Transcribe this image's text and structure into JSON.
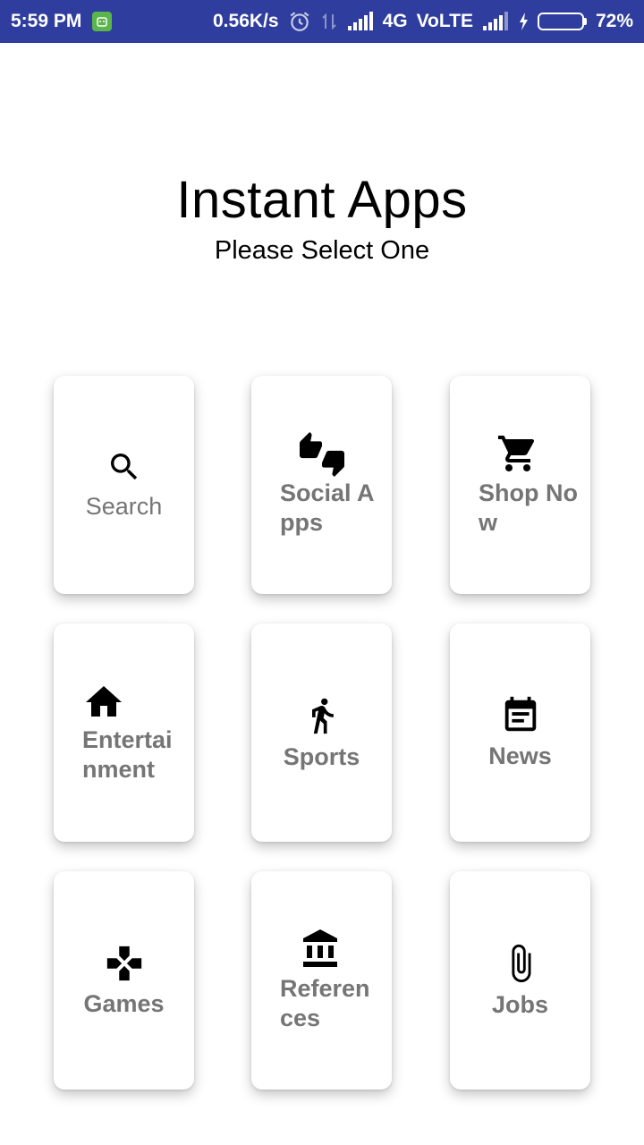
{
  "status_bar": {
    "time": "5:59 PM",
    "network_speed": "0.56K/s",
    "network_type": "4G",
    "volte": "VoLTE",
    "battery_percent": "72%",
    "battery_level": 0.72,
    "background_color": "#2f3e9e",
    "icons": [
      "notification-app-icon",
      "alarm-icon",
      "data-transfer-icon",
      "signal-icon",
      "signal-2-icon",
      "charging-icon",
      "battery-icon"
    ]
  },
  "header": {
    "title": "Instant Apps",
    "subtitle": "Please Select One"
  },
  "categories": [
    {
      "label": "Search",
      "icon": "search-icon"
    },
    {
      "label": "Social Apps",
      "icon": "thumbs-up-down-icon"
    },
    {
      "label": "Shop Now",
      "icon": "shopping-cart-icon"
    },
    {
      "label": "Entertainment",
      "icon": "home-icon"
    },
    {
      "label": "Sports",
      "icon": "walking-person-icon"
    },
    {
      "label": "News",
      "icon": "calendar-note-icon"
    },
    {
      "label": "Games",
      "icon": "gamepad-icon"
    },
    {
      "label": "References",
      "icon": "bank-icon"
    },
    {
      "label": "Jobs",
      "icon": "paperclip-icon"
    }
  ],
  "colors": {
    "label": "#757575",
    "icon": "#000000",
    "card_background": "#ffffff"
  }
}
